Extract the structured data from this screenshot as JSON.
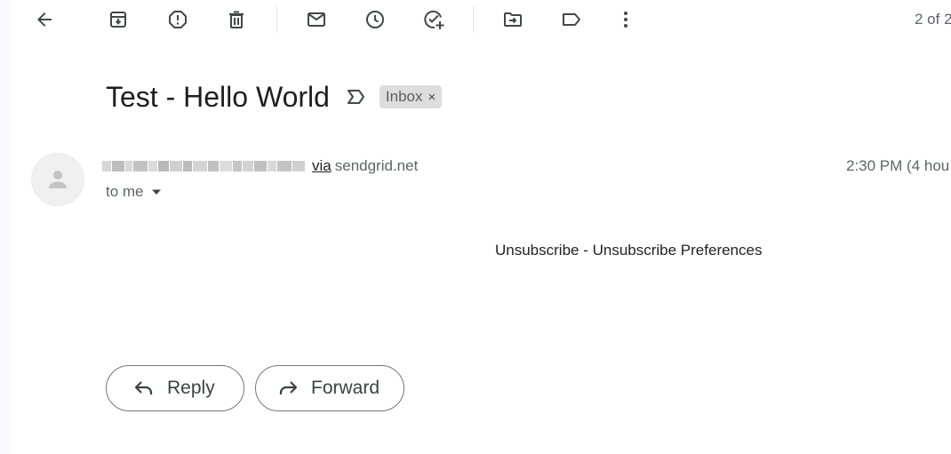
{
  "toolbar": {
    "items": [
      {
        "name": "back",
        "icon": "arrow-back-icon"
      },
      {
        "name": "archive",
        "icon": "archive-icon"
      },
      {
        "name": "report-spam",
        "icon": "report-spam-icon"
      },
      {
        "name": "delete",
        "icon": "trash-icon"
      },
      {
        "name": "mark-unread",
        "icon": "mail-icon"
      },
      {
        "name": "snooze",
        "icon": "clock-icon"
      },
      {
        "name": "add-task",
        "icon": "add-task-icon"
      },
      {
        "name": "move-to",
        "icon": "move-to-folder-icon"
      },
      {
        "name": "label",
        "icon": "label-icon"
      },
      {
        "name": "more",
        "icon": "more-vertical-icon"
      }
    ],
    "page_count": "2 of 2"
  },
  "email": {
    "subject": "Test - Hello World",
    "label": "Inbox",
    "label_remove": "×",
    "sender_via": "via",
    "sender_domain": "sendgrid.net",
    "timestamp": "2:30 PM (4 hou",
    "recipient": "to me",
    "body": "Unsubscribe - Unsubscribe Preferences"
  },
  "actions": {
    "reply": "Reply",
    "forward": "Forward"
  },
  "colors": {
    "icon": "#444746",
    "chip_bg": "#dddddd",
    "sidebar_bg": "#f6f8fc"
  }
}
